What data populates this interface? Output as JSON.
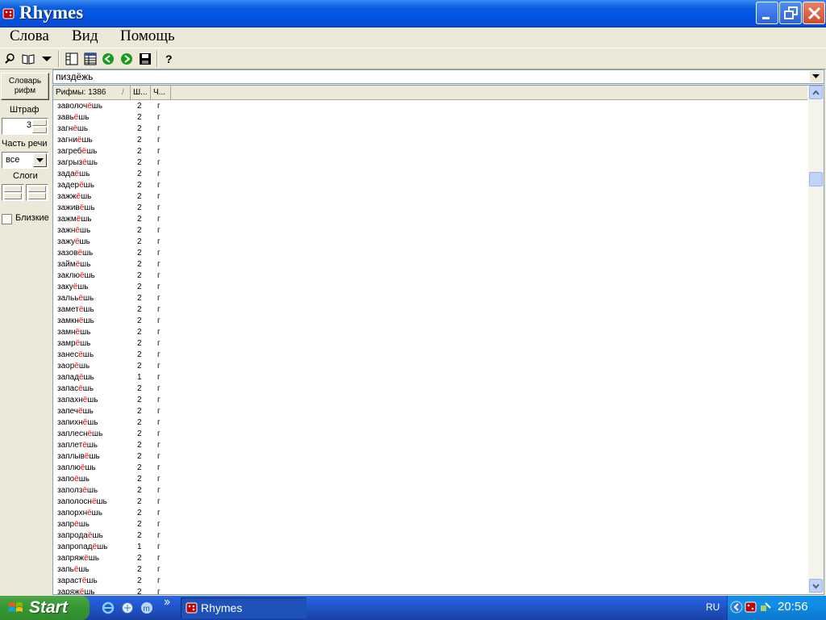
{
  "window": {
    "title": "Rhymes",
    "icon": "app-dice-icon"
  },
  "menu": [
    "Слова",
    "Вид",
    "Помощь"
  ],
  "toolbar": {
    "icons": [
      "clear-icon",
      "book-icon",
      "dropdown-arrow-icon",
      "panel-icon",
      "table-icon",
      "back-icon",
      "forward-icon",
      "save-icon",
      "help-icon"
    ]
  },
  "left_panel": {
    "dict_button": "Словарь рифм",
    "penalty_label": "Штраф",
    "penalty_value": "3",
    "pos_label": "Часть речи",
    "pos_value": "все",
    "syllables_label": "Слоги",
    "close_label": "Близкие",
    "close_checked": false
  },
  "search": {
    "value": "пиздёжь"
  },
  "list": {
    "columns": [
      "Рифмы: 1386",
      "Ш...",
      "Ч..."
    ],
    "sort_indicator": "/",
    "stress_color": "#E00000",
    "rows": [
      {
        "pre": "заволоч",
        "stressed": "ё",
        "post": "шь",
        "s": "2",
        "p": "г"
      },
      {
        "pre": "завь",
        "stressed": "ё",
        "post": "шь",
        "s": "2",
        "p": "г"
      },
      {
        "pre": "загн",
        "stressed": "ё",
        "post": "шь",
        "s": "2",
        "p": "г"
      },
      {
        "pre": "загни",
        "stressed": "ё",
        "post": "шь",
        "s": "2",
        "p": "г"
      },
      {
        "pre": "загреб",
        "stressed": "ё",
        "post": "шь",
        "s": "2",
        "p": "г"
      },
      {
        "pre": "загрыз",
        "stressed": "ё",
        "post": "шь",
        "s": "2",
        "p": "г"
      },
      {
        "pre": "зада",
        "stressed": "ё",
        "post": "шь",
        "s": "2",
        "p": "г"
      },
      {
        "pre": "задер",
        "stressed": "ё",
        "post": "шь",
        "s": "2",
        "p": "г"
      },
      {
        "pre": "зажж",
        "stressed": "ё",
        "post": "шь",
        "s": "2",
        "p": "г"
      },
      {
        "pre": "зажив",
        "stressed": "ё",
        "post": "шь",
        "s": "2",
        "p": "г"
      },
      {
        "pre": "зажм",
        "stressed": "ё",
        "post": "шь",
        "s": "2",
        "p": "г"
      },
      {
        "pre": "зажн",
        "stressed": "ё",
        "post": "шь",
        "s": "2",
        "p": "г"
      },
      {
        "pre": "зажу",
        "stressed": "ё",
        "post": "шь",
        "s": "2",
        "p": "г"
      },
      {
        "pre": "зазов",
        "stressed": "ё",
        "post": "шь",
        "s": "2",
        "p": "г"
      },
      {
        "pre": "займ",
        "stressed": "ё",
        "post": "шь",
        "s": "2",
        "p": "г"
      },
      {
        "pre": "заклю",
        "stressed": "ё",
        "post": "шь",
        "s": "2",
        "p": "г"
      },
      {
        "pre": "заку",
        "stressed": "ё",
        "post": "шь",
        "s": "2",
        "p": "г"
      },
      {
        "pre": "зальь",
        "stressed": "ё",
        "post": "шь",
        "s": "2",
        "p": "г"
      },
      {
        "pre": "замет",
        "stressed": "ё",
        "post": "шь",
        "s": "2",
        "p": "г"
      },
      {
        "pre": "замкн",
        "stressed": "ё",
        "post": "шь",
        "s": "2",
        "p": "г"
      },
      {
        "pre": "замн",
        "stressed": "ё",
        "post": "шь",
        "s": "2",
        "p": "г"
      },
      {
        "pre": "замр",
        "stressed": "ё",
        "post": "шь",
        "s": "2",
        "p": "г"
      },
      {
        "pre": "занес",
        "stressed": "ё",
        "post": "шь",
        "s": "2",
        "p": "г"
      },
      {
        "pre": "заор",
        "stressed": "ё",
        "post": "шь",
        "s": "2",
        "p": "г"
      },
      {
        "pre": "запад",
        "stressed": "ё",
        "post": "шь",
        "s": "1",
        "p": "г"
      },
      {
        "pre": "запас",
        "stressed": "ё",
        "post": "шь",
        "s": "2",
        "p": "г"
      },
      {
        "pre": "запахн",
        "stressed": "ё",
        "post": "шь",
        "s": "2",
        "p": "г"
      },
      {
        "pre": "запеч",
        "stressed": "ё",
        "post": "шь",
        "s": "2",
        "p": "г"
      },
      {
        "pre": "запихн",
        "stressed": "ё",
        "post": "шь",
        "s": "2",
        "p": "г"
      },
      {
        "pre": "заплесн",
        "stressed": "ё",
        "post": "шь",
        "s": "2",
        "p": "г"
      },
      {
        "pre": "заплет",
        "stressed": "ё",
        "post": "шь",
        "s": "2",
        "p": "г"
      },
      {
        "pre": "заплыв",
        "stressed": "ё",
        "post": "шь",
        "s": "2",
        "p": "г"
      },
      {
        "pre": "заплю",
        "stressed": "ё",
        "post": "шь",
        "s": "2",
        "p": "г"
      },
      {
        "pre": "запо",
        "stressed": "ё",
        "post": "шь",
        "s": "2",
        "p": "г"
      },
      {
        "pre": "заполз",
        "stressed": "ё",
        "post": "шь",
        "s": "2",
        "p": "г"
      },
      {
        "pre": "заполосн",
        "stressed": "ё",
        "post": "шь",
        "s": "2",
        "p": "г"
      },
      {
        "pre": "запорхн",
        "stressed": "ё",
        "post": "шь",
        "s": "2",
        "p": "г"
      },
      {
        "pre": "запр",
        "stressed": "ё",
        "post": "шь",
        "s": "2",
        "p": "г"
      },
      {
        "pre": "запрода",
        "stressed": "ё",
        "post": "шь",
        "s": "2",
        "p": "г"
      },
      {
        "pre": "запропад",
        "stressed": "ё",
        "post": "шь",
        "s": "1",
        "p": "г"
      },
      {
        "pre": "запряж",
        "stressed": "ё",
        "post": "шь",
        "s": "2",
        "p": "г"
      },
      {
        "pre": "запь",
        "stressed": "ё",
        "post": "шь",
        "s": "2",
        "p": "г"
      },
      {
        "pre": "зараст",
        "stressed": "ё",
        "post": "шь",
        "s": "2",
        "p": "г"
      },
      {
        "pre": "заряж",
        "stressed": "ё",
        "post": "шь",
        "s": "2",
        "p": "г"
      }
    ]
  },
  "taskbar": {
    "start_label": "Start",
    "task_label": "Rhymes",
    "lang": "RU",
    "clock": "20:56"
  }
}
